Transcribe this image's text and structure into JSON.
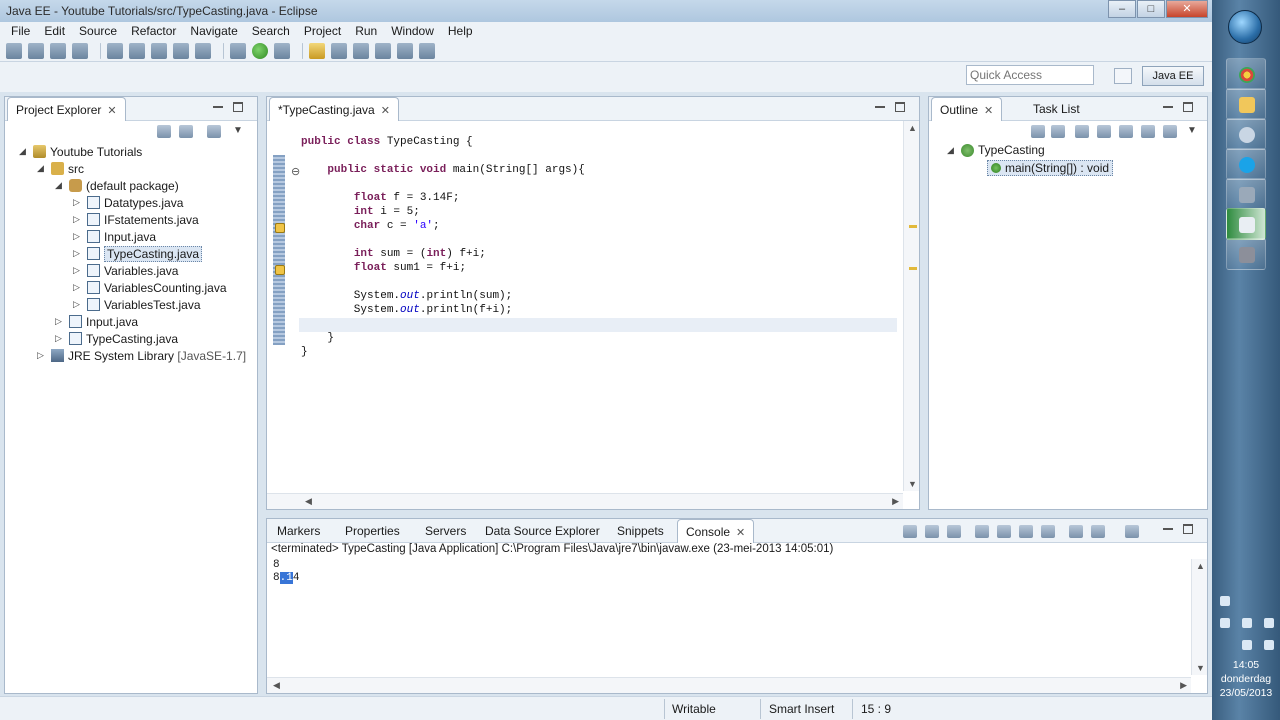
{
  "window": {
    "title": "Java EE - Youtube Tutorials/src/TypeCasting.java - Eclipse"
  },
  "menu": [
    "File",
    "Edit",
    "Source",
    "Refactor",
    "Navigate",
    "Search",
    "Project",
    "Run",
    "Window",
    "Help"
  ],
  "quick_access": {
    "placeholder": "Quick Access"
  },
  "perspective": {
    "label": "Java EE"
  },
  "project_explorer": {
    "tab": "Project Explorer",
    "items": [
      {
        "label": "Youtube Tutorials",
        "depth": 0,
        "type": "project",
        "expanded": true
      },
      {
        "label": "src",
        "depth": 1,
        "type": "src",
        "expanded": true
      },
      {
        "label": "(default package)",
        "depth": 2,
        "type": "package",
        "expanded": true
      },
      {
        "label": "Datatypes.java",
        "depth": 3,
        "type": "java"
      },
      {
        "label": "IFstatements.java",
        "depth": 3,
        "type": "java"
      },
      {
        "label": "Input.java",
        "depth": 3,
        "type": "java"
      },
      {
        "label": "TypeCasting.java",
        "depth": 3,
        "type": "java",
        "selected": true
      },
      {
        "label": "Variables.java",
        "depth": 3,
        "type": "java"
      },
      {
        "label": "VariablesCounting.java",
        "depth": 3,
        "type": "java"
      },
      {
        "label": "VariablesTest.java",
        "depth": 3,
        "type": "java"
      },
      {
        "label": "Input.java",
        "depth": 2,
        "type": "java"
      },
      {
        "label": "TypeCasting.java",
        "depth": 2,
        "type": "java"
      },
      {
        "label": "JRE System Library",
        "suffix": "[JavaSE-1.7]",
        "depth": 1,
        "type": "jar"
      }
    ]
  },
  "editor": {
    "tab": "*TypeCasting.java",
    "lines": [
      "public class TypeCasting {",
      "",
      "    public static void main(String[] args){",
      "",
      "        float f = 3.14F;",
      "        int i = 5;",
      "        char c = 'a';",
      "",
      "        int sum = (int) f+i;",
      "        float sum1 = f+i;",
      "",
      "        System.out.println(sum);",
      "        System.out.println(f+i);",
      "",
      "    }",
      "}"
    ]
  },
  "outline": {
    "tabs": [
      "Outline",
      "Task List"
    ],
    "class_name": "TypeCasting",
    "method": "main(String[]) : void"
  },
  "bottom": {
    "tabs": [
      "Markers",
      "Properties",
      "Servers",
      "Data Source Explorer",
      "Snippets",
      "Console"
    ],
    "console_header": "<terminated> TypeCasting [Java Application] C:\\Program Files\\Java\\jre7\\bin\\javaw.exe (23-mei-2013 14:05:01)",
    "output": [
      "8",
      "8.14"
    ],
    "output_selection": ".1"
  },
  "status": {
    "writable": "Writable",
    "insert": "Smart Insert",
    "position": "15 : 9"
  },
  "taskbar": {
    "time": "14:05",
    "day": "donderdag",
    "date": "23/05/2013"
  }
}
